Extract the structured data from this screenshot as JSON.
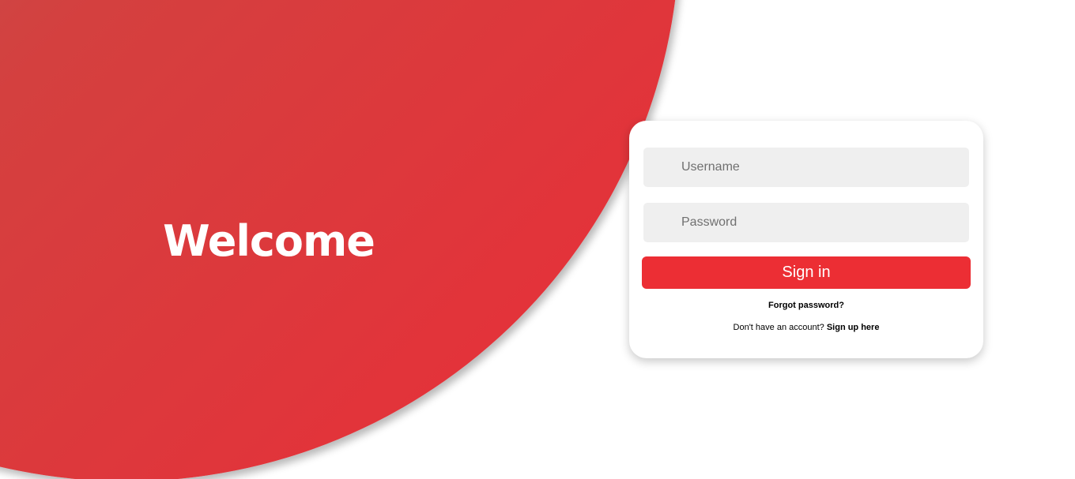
{
  "hero": {
    "title": "Welcome"
  },
  "login": {
    "username_placeholder": "Username",
    "password_placeholder": "Password",
    "signin_label": "Sign in",
    "forgot_label": "Forgot password?",
    "signup_prompt": "Don't have an account?",
    "signup_link": "Sign up here"
  },
  "colors": {
    "accent": "#ec2e34",
    "hero_gradient_start": "#b85a55",
    "hero_gradient_end": "#e3333a",
    "field_background": "#efefef"
  }
}
